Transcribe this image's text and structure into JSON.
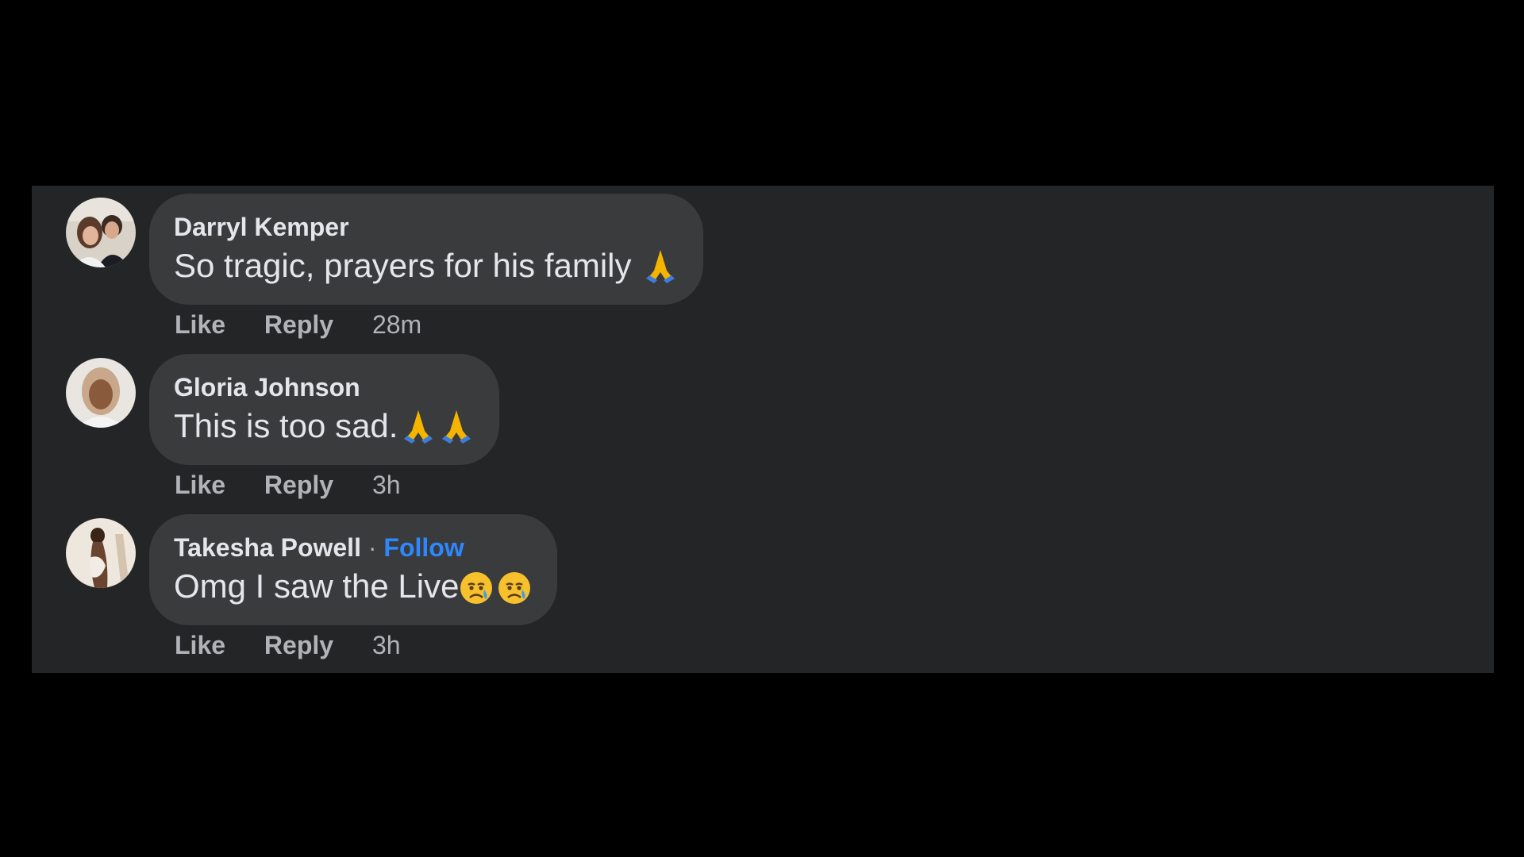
{
  "comments": [
    {
      "author": "Darryl Kemper",
      "text": "So tragic, prayers for his family",
      "emojis": [
        "folded-hands"
      ],
      "follow": null,
      "like_label": "Like",
      "reply_label": "Reply",
      "time": "28m"
    },
    {
      "author": "Gloria Johnson",
      "text": "This is too sad.",
      "emojis": [
        "folded-hands",
        "folded-hands"
      ],
      "follow": null,
      "like_label": "Like",
      "reply_label": "Reply",
      "time": "3h"
    },
    {
      "author": "Takesha Powell",
      "text": "Omg I saw the Live",
      "emojis": [
        "sad-but-relieved-face",
        "sad-but-relieved-face"
      ],
      "follow": "Follow",
      "separator": "·",
      "like_label": "Like",
      "reply_label": "Reply",
      "time": "3h"
    }
  ],
  "colors": {
    "page_background": "#000000",
    "panel_background": "#242526",
    "bubble_background": "#3a3b3c",
    "primary_text": "#e4e6eb",
    "secondary_text": "#b0b3b8",
    "follow_link": "#2d88ff"
  }
}
